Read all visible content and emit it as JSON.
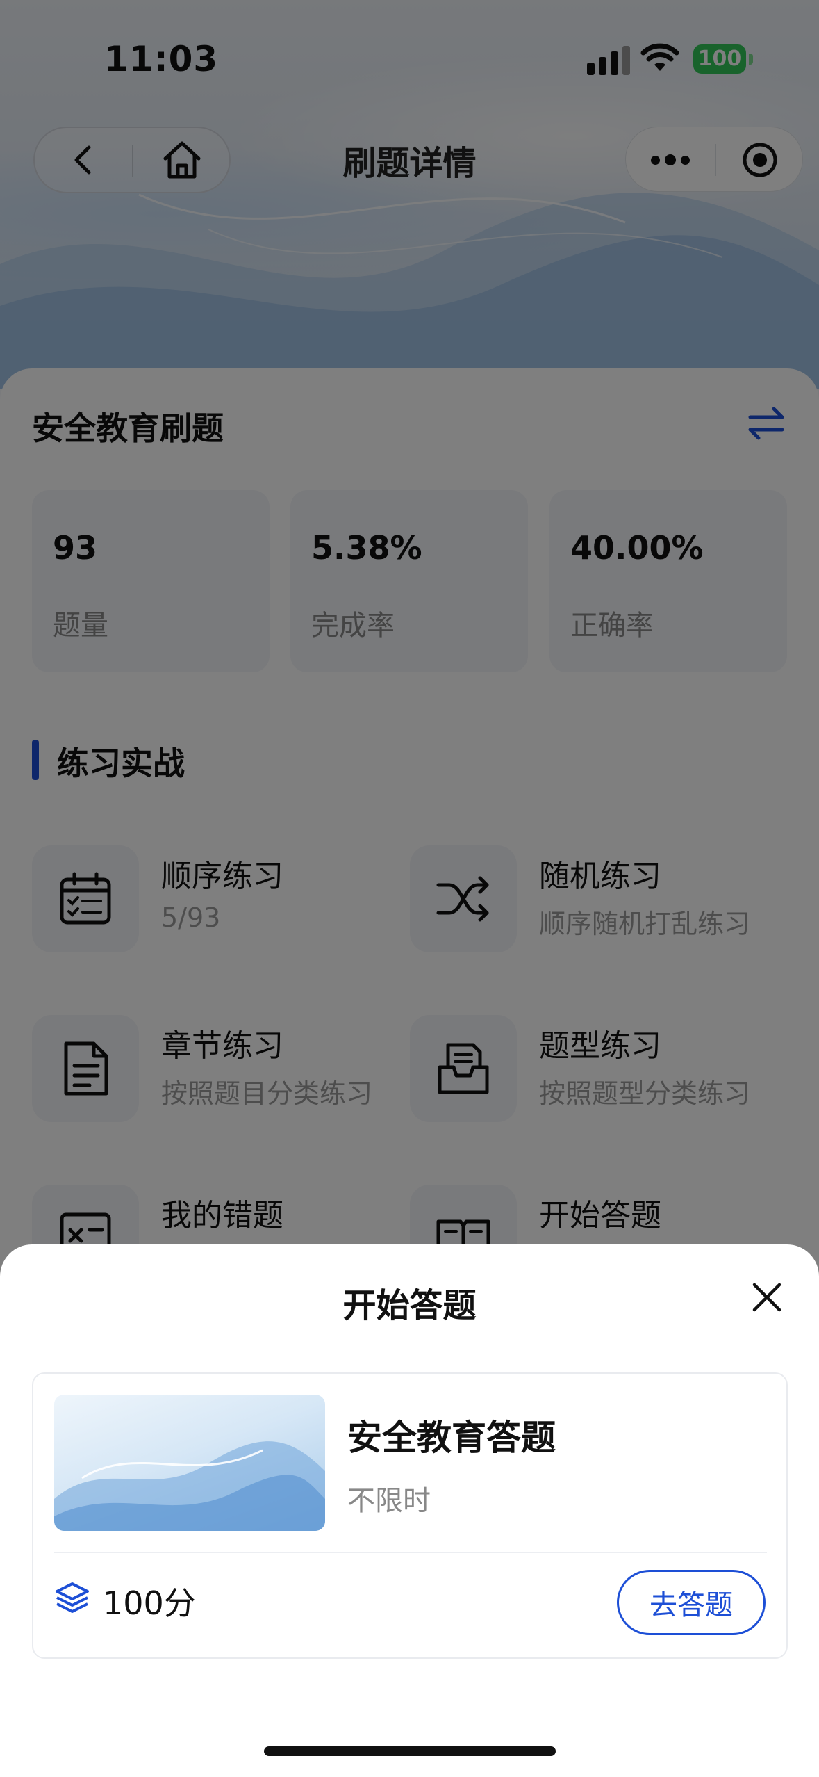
{
  "status_bar": {
    "time": "11:03",
    "battery": "100"
  },
  "nav": {
    "title": "刷题详情",
    "back_icon": "chevron-left-icon",
    "home_icon": "home-icon",
    "more_icon": "more-dots-icon",
    "close_icon": "target-icon"
  },
  "bank": {
    "title": "安全教育刷题",
    "switch_icon": "swap-arrows-icon",
    "stats": [
      {
        "value": "93",
        "label": "题量"
      },
      {
        "value": "5.38%",
        "label": "完成率"
      },
      {
        "value": "40.00%",
        "label": "正确率"
      }
    ]
  },
  "practice": {
    "section_title": "练习实战",
    "modes": [
      {
        "title": "顺序练习",
        "subtitle": "5/93",
        "icon": "calendar-check-icon"
      },
      {
        "title": "随机练习",
        "subtitle": "顺序随机打乱练习",
        "icon": "shuffle-icon"
      },
      {
        "title": "章节练习",
        "subtitle": "按照题目分类练习",
        "icon": "document-icon"
      },
      {
        "title": "题型练习",
        "subtitle": "按照题型分类练习",
        "icon": "inbox-icon"
      },
      {
        "title": "我的错题",
        "subtitle": "",
        "icon": "wrong-questions-icon"
      },
      {
        "title": "开始答题",
        "subtitle": "",
        "icon": "book-icon"
      }
    ]
  },
  "sheet": {
    "title": "开始答题",
    "close_icon": "close-icon",
    "exam": {
      "name": "安全教育答题",
      "time_limit": "不限时",
      "score": "100分",
      "score_icon": "layers-icon",
      "button": "去答题"
    }
  },
  "colors": {
    "accent": "#1d4fd6",
    "battery": "#33c759"
  }
}
